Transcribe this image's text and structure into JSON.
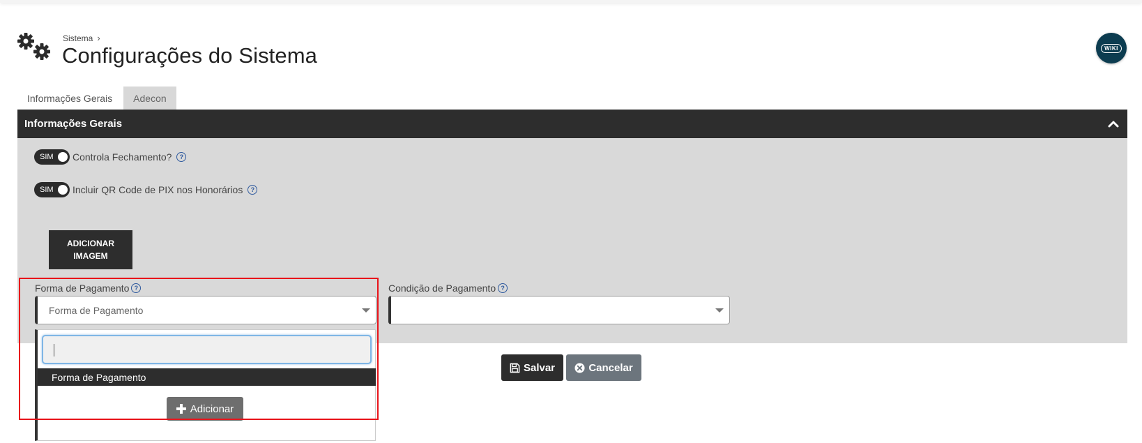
{
  "header": {
    "breadcrumb": "Sistema",
    "breadcrumb_sep": "›",
    "title": "Configurações do Sistema",
    "wiki_label": "WIKI"
  },
  "tabs": [
    {
      "label": "Informações Gerais"
    },
    {
      "label": "Adecon"
    }
  ],
  "panel": {
    "title": "Informações Gerais"
  },
  "toggles": [
    {
      "state": "SIM",
      "label": "Controla Fechamento?"
    },
    {
      "state": "SIM",
      "label": "Incluir QR Code de PIX nos Honorários"
    }
  ],
  "add_image": {
    "line1": "ADICIONAR",
    "line2": "IMAGEM"
  },
  "forma_pagamento": {
    "label": "Forma de Pagamento",
    "value": "Forma de Pagamento"
  },
  "condicao_pagamento": {
    "label": "Condição de Pagamento",
    "value": ""
  },
  "dropdown": {
    "search_value": "",
    "option": "Forma de Pagamento",
    "add_label": "Adicionar"
  },
  "actions": {
    "save_label": "Salvar",
    "cancel_label": "Cancelar"
  },
  "help_glyph": "?"
}
